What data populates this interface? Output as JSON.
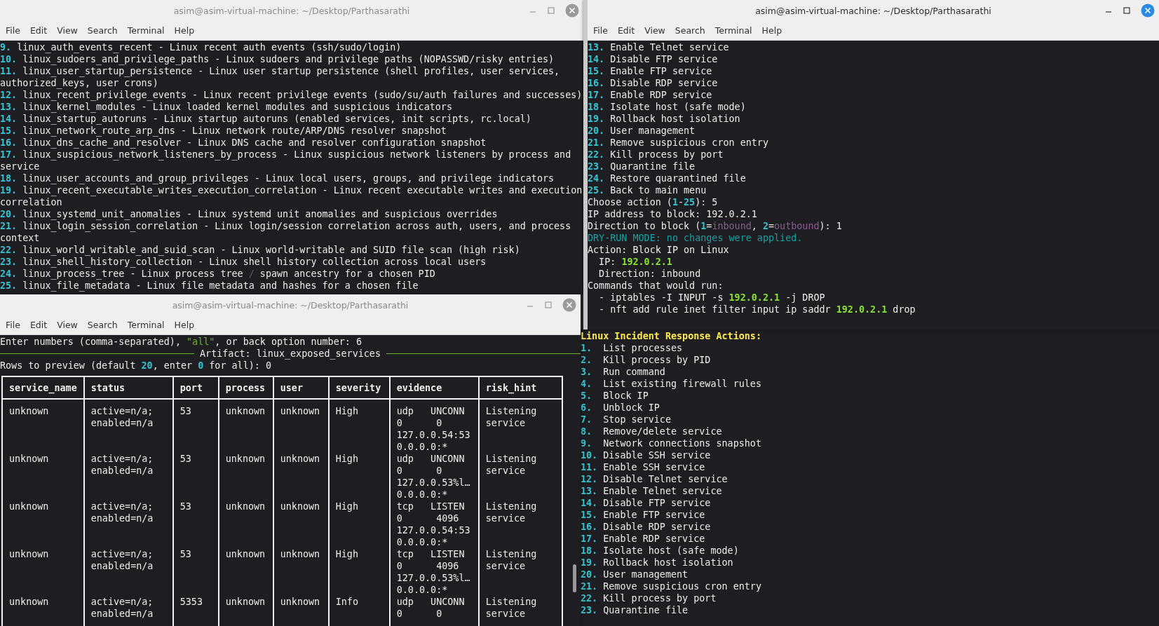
{
  "windows": [
    {
      "title": "asim@asim-virtual-machine: ~/Desktop/Parthasarathi",
      "active": false,
      "menu": [
        "File",
        "Edit",
        "View",
        "Search",
        "Terminal",
        "Help"
      ],
      "lines": [
        [
          {
            "kind": "num",
            "text": "9."
          },
          {
            "text": " linux_auth_events_recent - Linux recent auth events (ssh/sudo/login)"
          }
        ],
        [
          {
            "kind": "num",
            "text": "10."
          },
          {
            "text": " linux_sudoers_and_privilege_paths - Linux sudoers and privilege paths (NOPASSWD/risky entries)"
          }
        ],
        [
          {
            "kind": "num",
            "text": "11."
          },
          {
            "text": " linux_user_startup_persistence - Linux user startup persistence (shell profiles, user services,"
          }
        ],
        [
          {
            "text": "authorized_keys, user crons)"
          }
        ],
        [
          {
            "kind": "num",
            "text": "12."
          },
          {
            "text": " linux_recent_privilege_events - Linux recent privilege events (sudo/su/auth failures and successes)"
          }
        ],
        [
          {
            "kind": "num",
            "text": "13."
          },
          {
            "text": " linux_kernel_modules - Linux loaded kernel modules and suspicious indicators"
          }
        ],
        [
          {
            "kind": "num",
            "text": "14."
          },
          {
            "text": " linux_startup_autoruns - Linux startup autoruns (enabled services, init scripts, rc.local)"
          }
        ],
        [
          {
            "kind": "num",
            "text": "15."
          },
          {
            "text": " linux_network_route_arp_dns - Linux network route/ARP/DNS resolver snapshot"
          }
        ],
        [
          {
            "kind": "num",
            "text": "16."
          },
          {
            "text": " linux_dns_cache_and_resolver - Linux DNS cache and resolver configuration snapshot"
          }
        ],
        [
          {
            "kind": "num",
            "text": "17."
          },
          {
            "text": " linux_suspicious_network_listeners_by_process - Linux suspicious network listeners by process and"
          }
        ],
        [
          {
            "text": "service"
          }
        ],
        [
          {
            "kind": "num",
            "text": "18."
          },
          {
            "text": " linux_user_accounts_and_group_privileges - Linux local users, groups, and privilege indicators"
          }
        ],
        [
          {
            "kind": "num",
            "text": "19."
          },
          {
            "text": " linux_recent_executable_writes_execution_correlation - Linux recent executable writes and execution"
          }
        ],
        [
          {
            "text": "correlation"
          }
        ],
        [
          {
            "kind": "num",
            "text": "20."
          },
          {
            "text": " linux_systemd_unit_anomalies - Linux systemd unit anomalies and suspicious overrides"
          }
        ],
        [
          {
            "kind": "num",
            "text": "21."
          },
          {
            "text": " linux_login_session_correlation - Linux login/session correlation across auth, users, and process"
          }
        ],
        [
          {
            "text": "context"
          }
        ],
        [
          {
            "kind": "num",
            "text": "22."
          },
          {
            "text": " linux_world_writable_and_suid_scan - Linux world-writable and SUID file scan (high risk)"
          }
        ],
        [
          {
            "kind": "num",
            "text": "23."
          },
          {
            "text": " linux_shell_history_collection - Linux shell history collection across local users"
          }
        ],
        [
          {
            "kind": "num",
            "text": "24."
          },
          {
            "text": " linux_process_tree - Linux process tree "
          },
          {
            "kind": "dim",
            "text": "/"
          },
          {
            "text": " spawn ancestry for a chosen PID"
          }
        ],
        [
          {
            "kind": "num",
            "text": "25."
          },
          {
            "text": " linux_file_metadata - Linux file metadata and hashes for a chosen file"
          }
        ]
      ]
    },
    {
      "title": "asim@asim-virtual-machine: ~/Desktop/Parthasarathi",
      "active": true,
      "menu": [
        "File",
        "Edit",
        "View",
        "Search",
        "Terminal",
        "Help"
      ],
      "lines": [
        [
          {
            "kind": "num",
            "text": "13."
          },
          {
            "text": " Enable Telnet service"
          }
        ],
        [
          {
            "kind": "num",
            "text": "14."
          },
          {
            "text": " Disable FTP service"
          }
        ],
        [
          {
            "kind": "num",
            "text": "15."
          },
          {
            "text": " Enable FTP service"
          }
        ],
        [
          {
            "kind": "num",
            "text": "16."
          },
          {
            "text": " Disable RDP service"
          }
        ],
        [
          {
            "kind": "num",
            "text": "17."
          },
          {
            "text": " Enable RDP service"
          }
        ],
        [
          {
            "kind": "num",
            "text": "18."
          },
          {
            "text": " Isolate host (safe mode)"
          }
        ],
        [
          {
            "kind": "num",
            "text": "19."
          },
          {
            "text": " Rollback host isolation"
          }
        ],
        [
          {
            "kind": "num",
            "text": "20."
          },
          {
            "text": " User management"
          }
        ],
        [
          {
            "kind": "num",
            "text": "21."
          },
          {
            "text": " Remove suspicious cron entry"
          }
        ],
        [
          {
            "kind": "num",
            "text": "22."
          },
          {
            "text": " Kill process by port"
          }
        ],
        [
          {
            "kind": "num",
            "text": "23."
          },
          {
            "text": " Quarantine file"
          }
        ],
        [
          {
            "kind": "num",
            "text": "24."
          },
          {
            "text": " Restore quarantined file"
          }
        ],
        [
          {
            "kind": "num",
            "text": "25."
          },
          {
            "text": " Back to main menu"
          }
        ],
        [
          {
            "text": "Choose action ("
          },
          {
            "kind": "num",
            "text": "1"
          },
          {
            "text": "-"
          },
          {
            "kind": "num",
            "text": "25"
          },
          {
            "text": "): 5"
          }
        ],
        [
          {
            "text": "IP address to block: 192.0.2.1"
          }
        ],
        [
          {
            "text": "Direction to block ("
          },
          {
            "kind": "num",
            "text": "1"
          },
          {
            "text": "="
          },
          {
            "kind": "option",
            "text": "inbound"
          },
          {
            "text": ", "
          },
          {
            "kind": "num",
            "text": "2"
          },
          {
            "text": "="
          },
          {
            "kind": "option",
            "text": "outbound"
          },
          {
            "text": "): 1"
          }
        ],
        [
          {
            "kind": "notice",
            "text": "DRY-RUN MODE: no changes were applied."
          }
        ],
        [
          {
            "text": "Action: Block IP on Linux"
          }
        ],
        [
          {
            "text": "  IP: "
          },
          {
            "kind": "ip",
            "text": "192.0.2.1"
          }
        ],
        [
          {
            "text": "  Direction: inbound"
          }
        ],
        [
          {
            "text": "Commands that would run:"
          }
        ],
        [
          {
            "text": "  - iptables -I INPUT -s "
          },
          {
            "kind": "ip",
            "text": "192.0.2.1"
          },
          {
            "text": " -j DROP"
          }
        ],
        [
          {
            "text": "  - nft add rule inet filter input ip saddr "
          },
          {
            "kind": "ip",
            "text": "192.0.2.1"
          },
          {
            "text": " drop"
          }
        ]
      ]
    },
    {
      "title": "asim@asim-virtual-machine: ~/Desktop/Parthasarathi",
      "active": false,
      "menu": [
        "File",
        "Edit",
        "View",
        "Search",
        "Terminal",
        "Help"
      ],
      "lines": [
        [
          {
            "text": "Enter numbers (comma-separated), "
          },
          {
            "kind": "quote",
            "text": "\"all\""
          },
          {
            "text": ", or back option number: 6"
          }
        ]
      ],
      "artifact": "Artifact: linux_exposed_services",
      "lines_after": [
        [
          {
            "text": "Rows to preview (default "
          },
          {
            "kind": "num",
            "text": "20"
          },
          {
            "text": ", enter "
          },
          {
            "kind": "num",
            "text": "0"
          },
          {
            "text": " for all): 0"
          }
        ]
      ],
      "table": {
        "columns": [
          "service_name",
          "status",
          "port",
          "process",
          "user",
          "severity",
          "evidence",
          "risk_hint"
        ],
        "rows": [
          [
            "unknown",
            "active=n/a;\nenabled=n/a",
            "53",
            "unknown",
            "unknown",
            "High",
            "udp   UNCONN\n0      0\n127.0.0.54:53\n0.0.0.0:*",
            "Listening\nservice"
          ],
          [
            "unknown",
            "active=n/a;\nenabled=n/a",
            "53",
            "unknown",
            "unknown",
            "High",
            "udp   UNCONN\n0      0\n127.0.0.53%l…\n0.0.0.0:*",
            "Listening\nservice"
          ],
          [
            "unknown",
            "active=n/a;\nenabled=n/a",
            "53",
            "unknown",
            "unknown",
            "High",
            "tcp   LISTEN\n0      4096\n127.0.0.54:53\n0.0.0.0:*",
            "Listening\nservice"
          ],
          [
            "unknown",
            "active=n/a;\nenabled=n/a",
            "53",
            "unknown",
            "unknown",
            "High",
            "tcp   LISTEN\n0      4096\n127.0.0.53%l…\n0.0.0.0:*",
            "Listening\nservice"
          ],
          [
            "unknown",
            "active=n/a;\nenabled=n/a",
            "5353",
            "unknown",
            "unknown",
            "Info",
            "udp   UNCONN\n0      0",
            "Listening\nservice"
          ]
        ]
      }
    },
    {
      "lines": [
        [
          {
            "kind": "heading",
            "text": "Linux Incident Response Actions:"
          }
        ],
        [
          {
            "kind": "num",
            "text": "1."
          },
          {
            "text": "  List processes"
          }
        ],
        [
          {
            "kind": "num",
            "text": "2."
          },
          {
            "text": "  Kill process by PID"
          }
        ],
        [
          {
            "kind": "num",
            "text": "3."
          },
          {
            "text": "  Run command"
          }
        ],
        [
          {
            "kind": "num",
            "text": "4."
          },
          {
            "text": "  List existing firewall rules"
          }
        ],
        [
          {
            "kind": "num",
            "text": "5."
          },
          {
            "text": "  Block IP"
          }
        ],
        [
          {
            "kind": "num",
            "text": "6."
          },
          {
            "text": "  Unblock IP"
          }
        ],
        [
          {
            "kind": "num",
            "text": "7."
          },
          {
            "text": "  Stop service"
          }
        ],
        [
          {
            "kind": "num",
            "text": "8."
          },
          {
            "text": "  Remove/delete service"
          }
        ],
        [
          {
            "kind": "num",
            "text": "9."
          },
          {
            "text": "  Network connections snapshot"
          }
        ],
        [
          {
            "kind": "num",
            "text": "10."
          },
          {
            "text": " Disable SSH service"
          }
        ],
        [
          {
            "kind": "num",
            "text": "11."
          },
          {
            "text": " Enable SSH service"
          }
        ],
        [
          {
            "kind": "num",
            "text": "12."
          },
          {
            "text": " Disable Telnet service"
          }
        ],
        [
          {
            "kind": "num",
            "text": "13."
          },
          {
            "text": " Enable Telnet service"
          }
        ],
        [
          {
            "kind": "num",
            "text": "14."
          },
          {
            "text": " Disable FTP service"
          }
        ],
        [
          {
            "kind": "num",
            "text": "15."
          },
          {
            "text": " Enable FTP service"
          }
        ],
        [
          {
            "kind": "num",
            "text": "16."
          },
          {
            "text": " Disable RDP service"
          }
        ],
        [
          {
            "kind": "num",
            "text": "17."
          },
          {
            "text": " Enable RDP service"
          }
        ],
        [
          {
            "kind": "num",
            "text": "18."
          },
          {
            "text": " Isolate host (safe mode)"
          }
        ],
        [
          {
            "kind": "num",
            "text": "19."
          },
          {
            "text": " Rollback host isolation"
          }
        ],
        [
          {
            "kind": "num",
            "text": "20."
          },
          {
            "text": " User management"
          }
        ],
        [
          {
            "kind": "num",
            "text": "21."
          },
          {
            "text": " Remove suspicious cron entry"
          }
        ],
        [
          {
            "kind": "num",
            "text": "22."
          },
          {
            "text": " Kill process by port"
          }
        ],
        [
          {
            "kind": "num",
            "text": "23."
          },
          {
            "text": " Quarantine file"
          }
        ]
      ]
    }
  ]
}
